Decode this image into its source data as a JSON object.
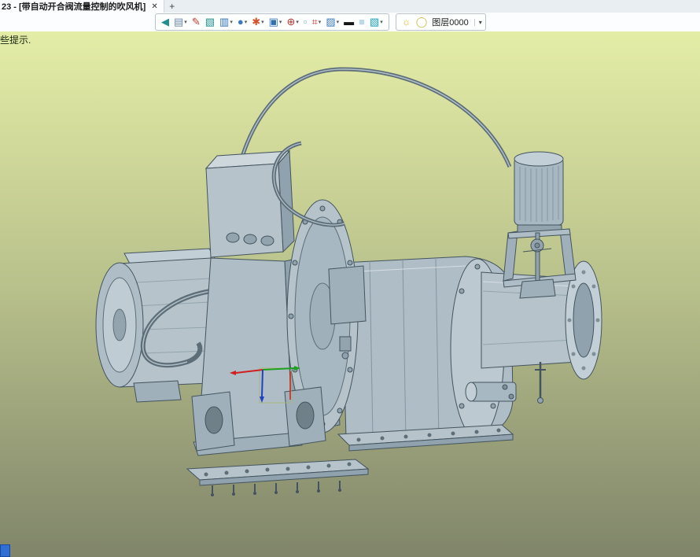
{
  "tab_bar": {
    "title": "23 - [带自动开合阀流量控制的吹风机]",
    "close_glyph": "✕",
    "new_tab_glyph": "+"
  },
  "hint_text": "些提示.",
  "toolbar": {
    "dropdown_glyph": "▾",
    "icons": [
      {
        "name": "import-model-icon",
        "glyph": "◀",
        "color": "#1f8f8f",
        "dropdown": false
      },
      {
        "name": "print-icon",
        "glyph": "▤",
        "color": "#6b87a5",
        "dropdown": true
      },
      {
        "name": "sketch-pen-icon",
        "glyph": "✎",
        "color": "#c23b2e",
        "dropdown": false
      },
      {
        "name": "solid-box-icon",
        "glyph": "▧",
        "color": "#1f8f8f",
        "dropdown": false
      },
      {
        "name": "extrude-feature-icon",
        "glyph": "▥",
        "color": "#2f6fb5",
        "dropdown": true
      },
      {
        "name": "sphere-feature-icon",
        "glyph": "●",
        "color": "#3a7ac2",
        "dropdown": true
      },
      {
        "name": "revolve-wheel-icon",
        "glyph": "✱",
        "color": "#d2542c",
        "dropdown": true
      },
      {
        "name": "sketch-plane-icon",
        "glyph": "▣",
        "color": "#2f6fb5",
        "dropdown": true
      },
      {
        "name": "snap-target-icon",
        "glyph": "⊕",
        "color": "#b23434",
        "dropdown": true
      },
      {
        "name": "blank-view-icon",
        "glyph": "▫",
        "color": "#8aa0b2",
        "dropdown": false
      },
      {
        "name": "dimension-icon",
        "glyph": "⌗",
        "color": "#c23b2e",
        "dropdown": true
      },
      {
        "name": "render-view-icon",
        "glyph": "▨",
        "color": "#3a7ac2",
        "dropdown": true
      },
      {
        "name": "line-width-icon",
        "glyph": "▬",
        "color": "#161616",
        "dropdown": false
      },
      {
        "name": "background-color-icon",
        "glyph": "■",
        "color": "#bcd9ec",
        "dropdown": false
      },
      {
        "name": "layers-panel-icon",
        "glyph": "▧",
        "color": "#15a0b8",
        "dropdown": true
      }
    ],
    "layer_group": {
      "bulb_glyph": "☼",
      "bulb_color": "#e8b93c",
      "swatch_glyph": "◯",
      "swatch_color": "#c9bd4e",
      "layer_value": "图层0000"
    }
  },
  "canvas": {
    "bg_top": "#e4eda6",
    "bg_mid": "#b9c18c",
    "bg_bottom": "#80856a",
    "model_color": "#b6c3cb",
    "taskbar_chip_color": "#2f6fd6"
  }
}
